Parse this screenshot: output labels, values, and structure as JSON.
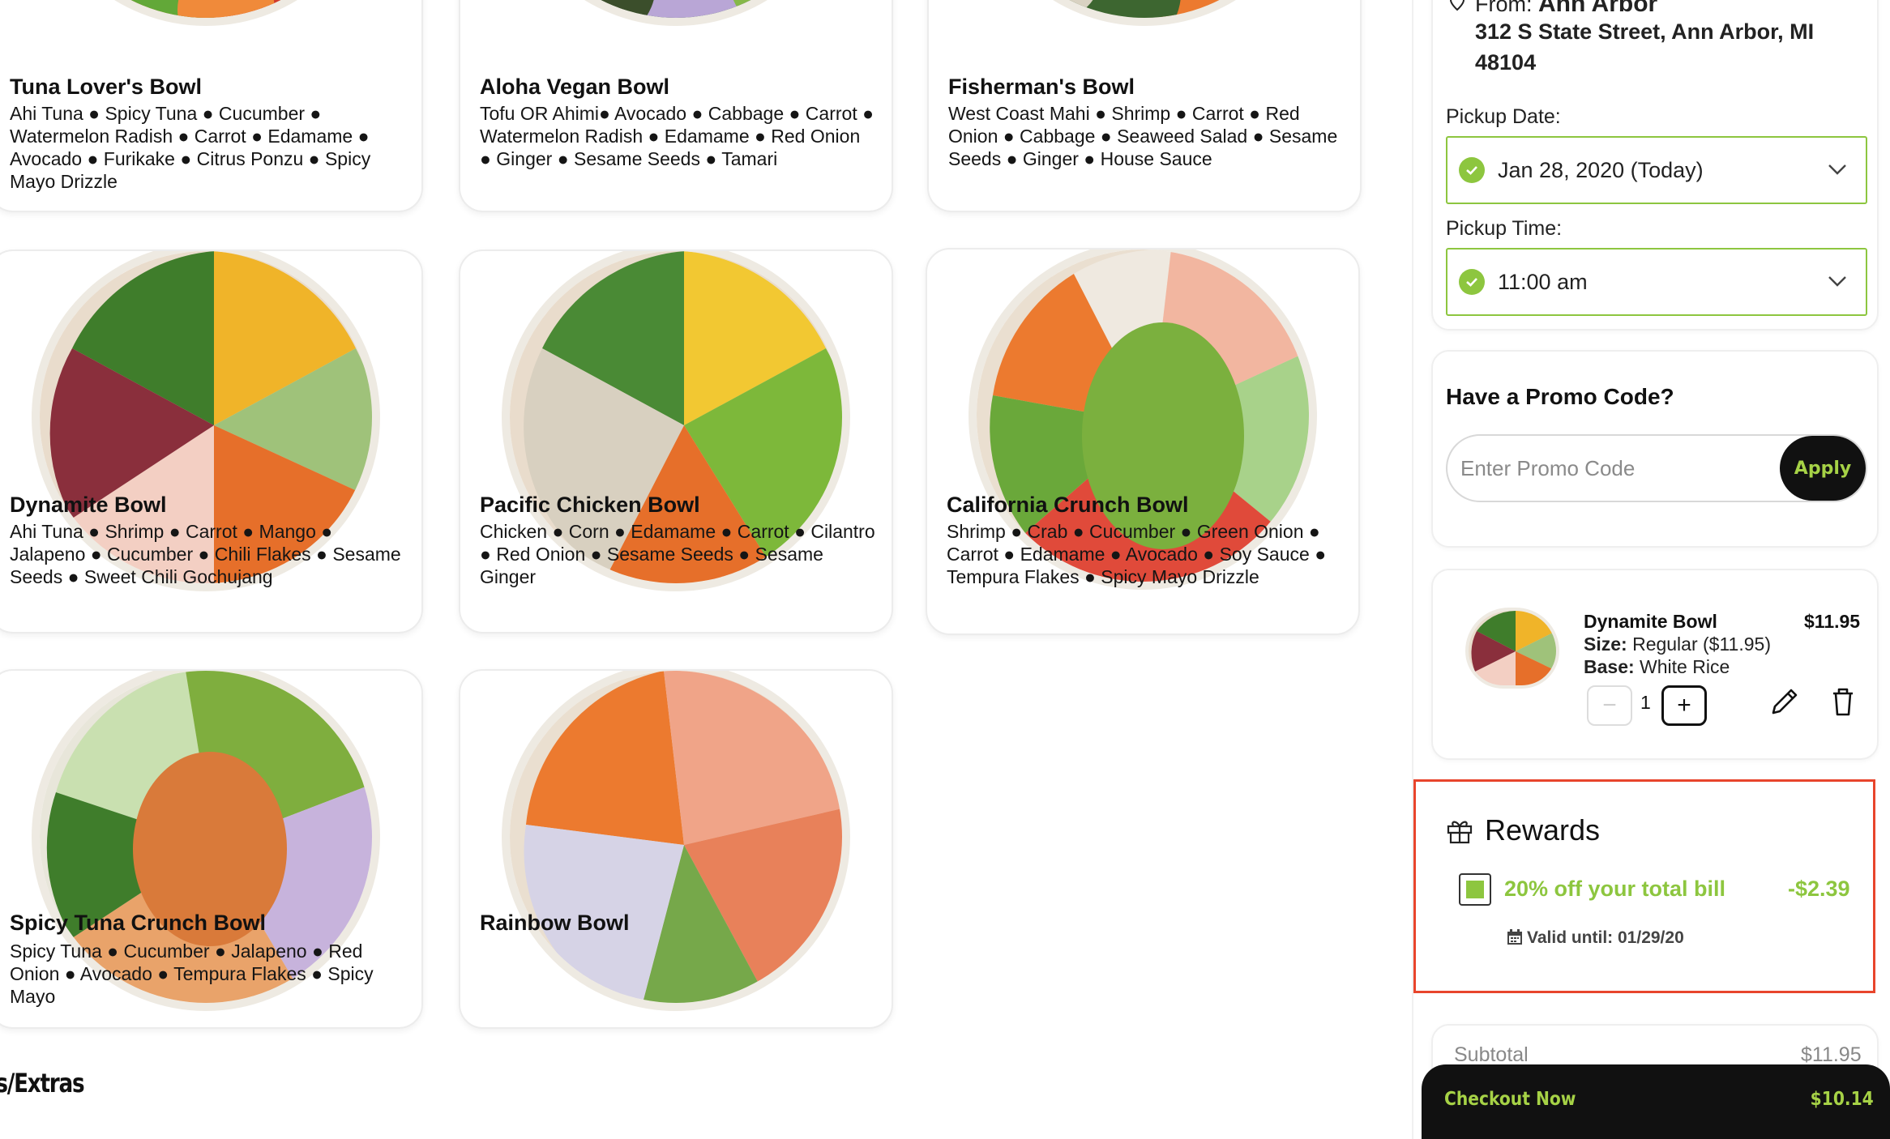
{
  "menu": {
    "bowls": [
      {
        "name": "Tuna Lover's Bowl",
        "ingredients": "Ahi Tuna ● Spicy Tuna ● Cucumber ● Watermelon Radish ● Carrot ● Edamame ● Avocado ● Furikake ● Citrus Ponzu ● Spicy Mayo Drizzle"
      },
      {
        "name": "Aloha Vegan Bowl",
        "ingredients": "Tofu OR Ahimi● Avocado ● Cabbage ● Carrot ● Watermelon Radish ● Edamame ● Red Onion ● Ginger ● Sesame Seeds ● Tamari"
      },
      {
        "name": "Fisherman's Bowl",
        "ingredients": "West Coast Mahi ● Shrimp ● Carrot ● Red Onion ● Cabbage ● Seaweed Salad ● Sesame Seeds ● Ginger ● House Sauce"
      },
      {
        "name": "Dynamite Bowl",
        "ingredients": "Ahi Tuna ● Shrimp ● Carrot ● Mango ● Jalapeno ● Cucumber ● Chili Flakes ● Sesame Seeds ● Sweet Chili Gochujang"
      },
      {
        "name": "Pacific Chicken Bowl",
        "ingredients": "Chicken ● Corn ● Edamame ● Carrot ● Cilantro ● Red Onion ● Sesame Seeds ● Sesame Ginger"
      },
      {
        "name": "California Crunch Bowl",
        "ingredients": "Shrimp ● Crab ● Cucumber ● Green Onion ● Carrot ● Edamame ● Avocado ● Soy Sauce ● Tempura Flakes ● Spicy Mayo Drizzle"
      },
      {
        "name": "Spicy Tuna Crunch Bowl",
        "ingredients": "Spicy Tuna ● Cucumber ● Jalapeno ● Red Onion ● Avocado ● Tempura Flakes ● Spicy Mayo"
      },
      {
        "name": "Rainbow Bowl",
        "ingredients": ""
      }
    ],
    "section_heading": "les/Extras"
  },
  "pickup": {
    "from_label": "From: ",
    "location": "Ann Arbor",
    "address": "312 S State Street, Ann Arbor, MI 48104",
    "date_label": "Pickup Date:",
    "date_value": "Jan 28, 2020 (Today)",
    "time_label": "Pickup Time:",
    "time_value": "11:00 am"
  },
  "promo": {
    "title": "Have a Promo Code?",
    "placeholder": "Enter Promo Code",
    "apply_label": "Apply"
  },
  "cart": {
    "item_name": "Dynamite Bowl",
    "price": "$11.95",
    "size_label": "Size:",
    "size_value": " Regular ($11.95)",
    "base_label": "Base:",
    "base_value": " White Rice",
    "quantity": "1",
    "minus_symbol": "−",
    "plus_symbol": "+"
  },
  "rewards": {
    "title": "Rewards",
    "offer": "20% off your total bill",
    "discount": "-$2.39",
    "valid": "Valid until: 01/29/20",
    "checked": true
  },
  "summary": {
    "subtotal_label": "Subtotal",
    "subtotal_value": "$11.95",
    "checkout_label": "Checkout Now",
    "checkout_total": "$10.14"
  },
  "colors": {
    "accent_green": "#8dc63f",
    "checkout_text": "#a6d246",
    "highlight_red": "#e8452c",
    "dark": "#111111"
  }
}
